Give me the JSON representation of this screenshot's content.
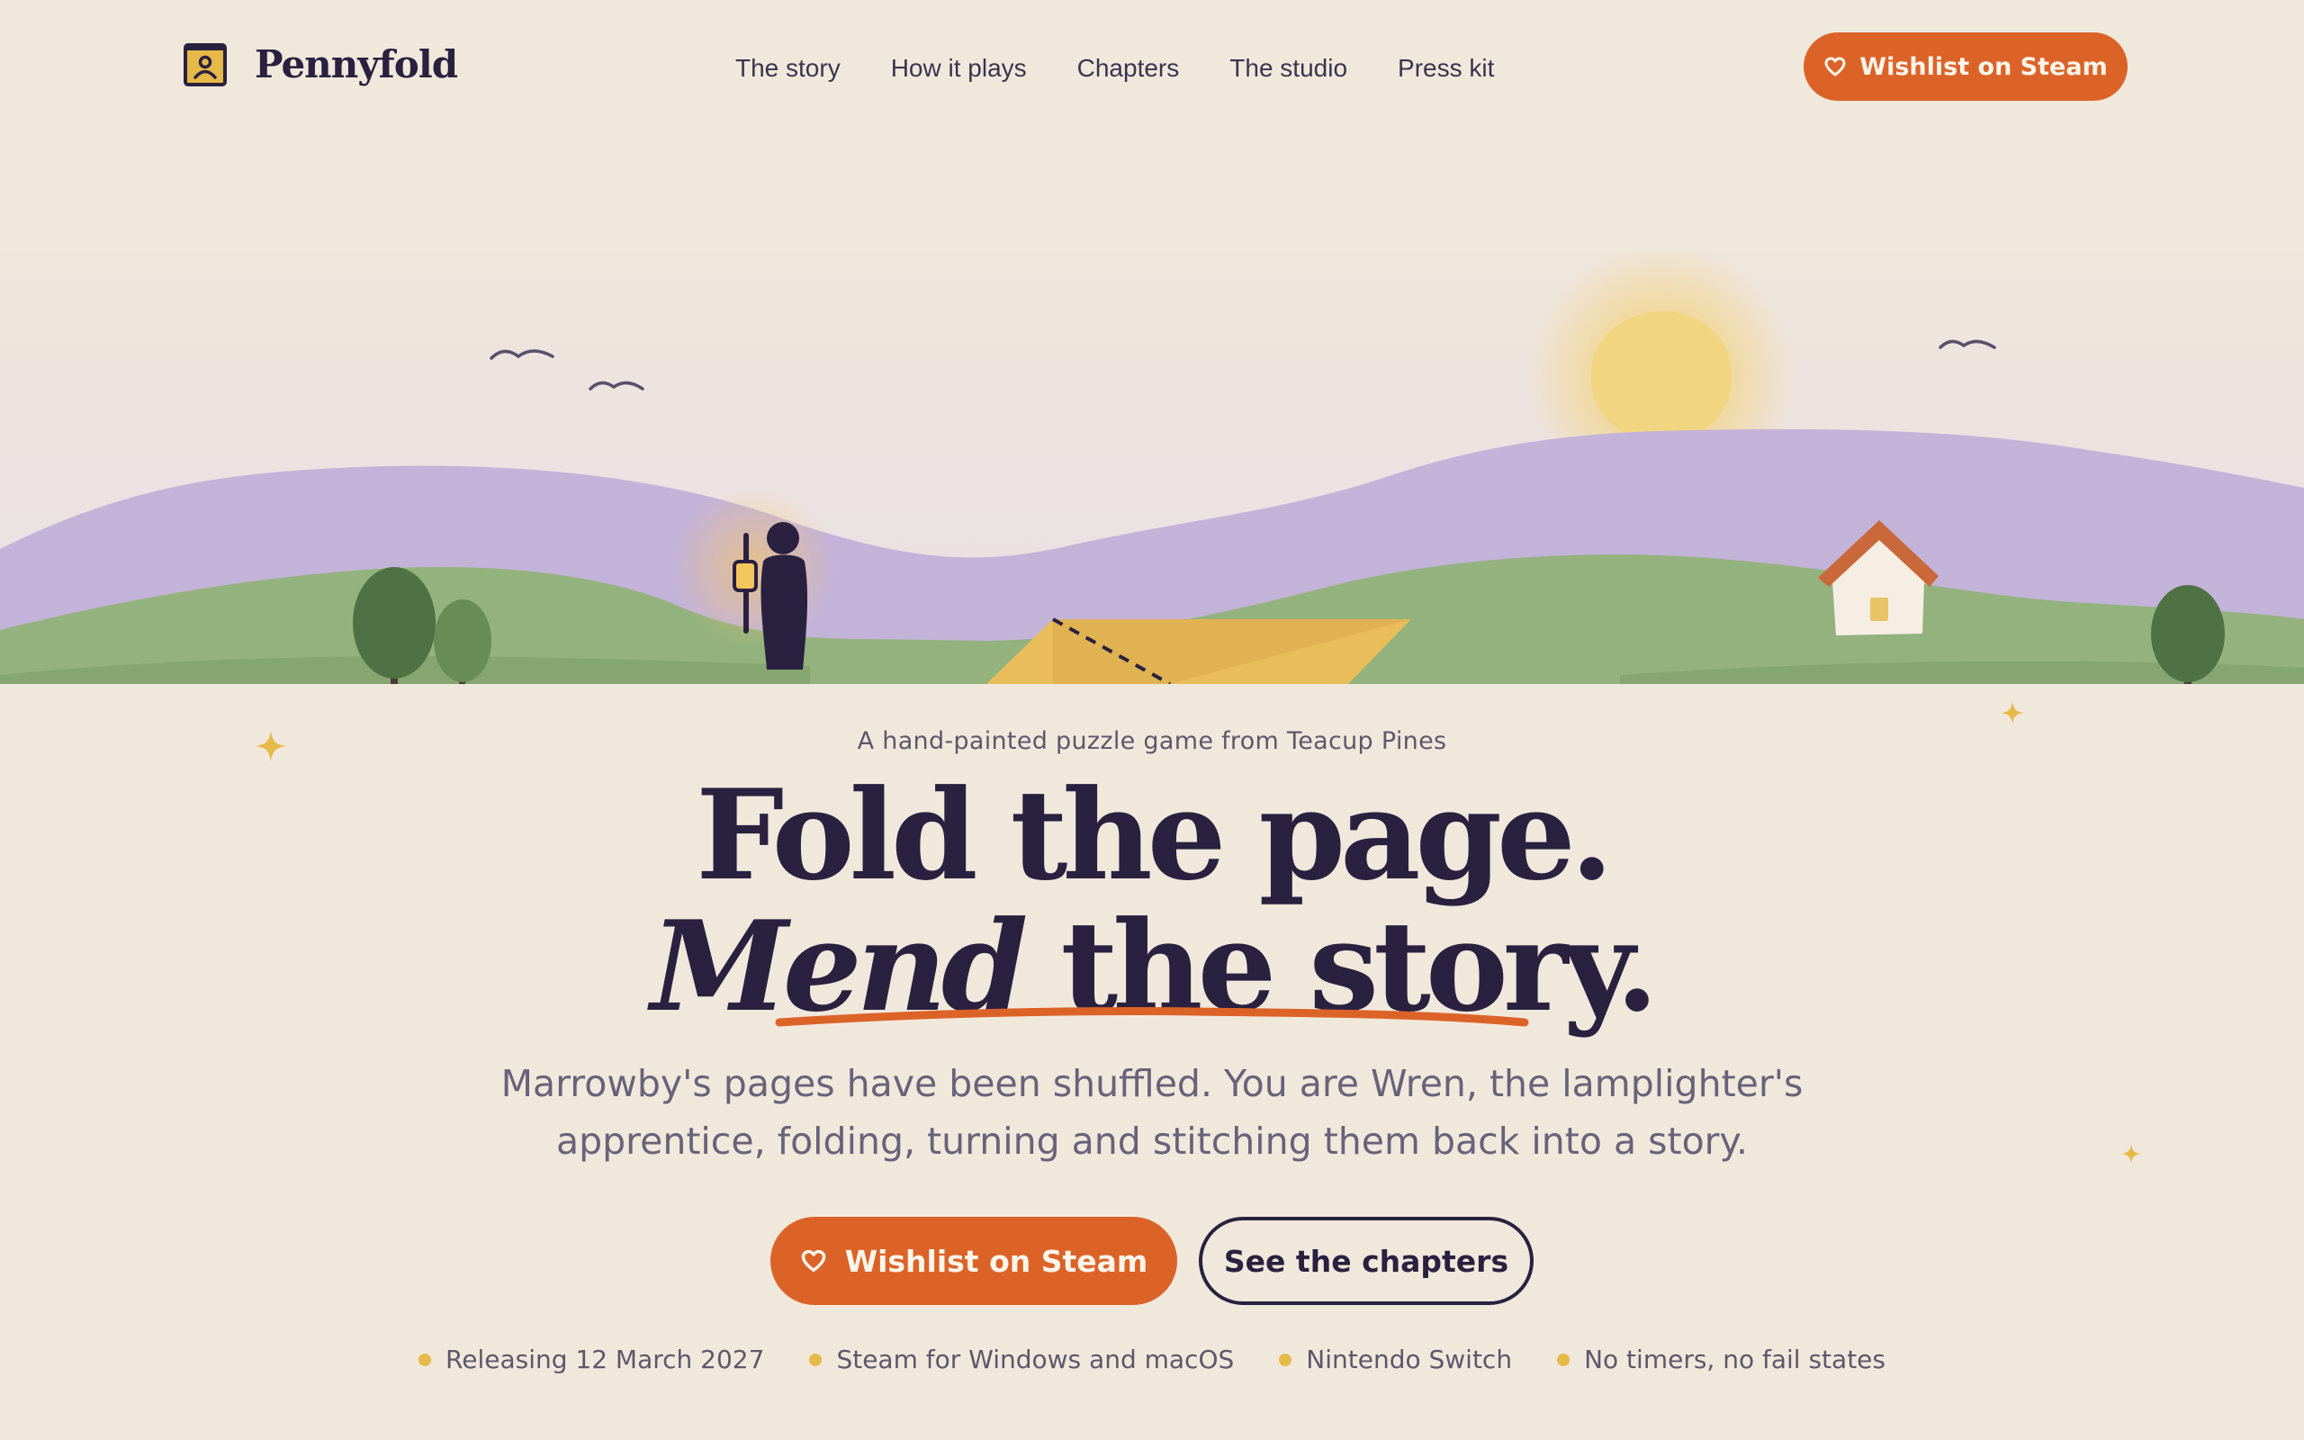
{
  "brand": {
    "name": "Pennyfold",
    "logo_icon": "framed-figure-icon"
  },
  "nav": {
    "items": [
      {
        "label": "The story"
      },
      {
        "label": "How it plays"
      },
      {
        "label": "Chapters"
      },
      {
        "label": "The studio"
      },
      {
        "label": "Press kit"
      }
    ]
  },
  "header_cta": {
    "label": "Wishlist on Steam",
    "icon": "heart-icon"
  },
  "hero": {
    "tagline": "A hand-painted puzzle game from Teacup Pines",
    "headline_line1": "Fold the page.",
    "headline_line2_emphasis": "Mend",
    "headline_line2_rest": " the story.",
    "lede_line1": "Marrowby's pages have been shuffled. You are Wren, the lamplighter's",
    "lede_line2": "apprentice, folding, turning and stitching them back into a story.",
    "primary_cta": "Wishlist on Steam",
    "secondary_cta": "See the chapters",
    "facts": [
      "Releasing 12 March 2027",
      "Steam for Windows and macOS",
      "Nintendo Switch",
      "No timers, no fail states"
    ]
  },
  "colors": {
    "background": "#f1e8dc",
    "accent": "#dc6328",
    "ink": "#2a2140",
    "gold": "#e6b948",
    "lavender_hills": "#c3b1d7",
    "green_hills": "#8fb07a"
  }
}
